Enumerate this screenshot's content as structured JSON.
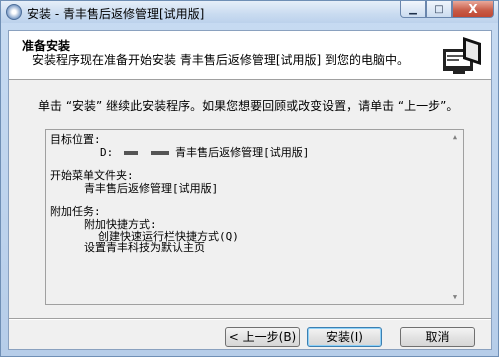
{
  "window": {
    "title": "安装 - 青丰售后返修管理[试用版]",
    "minimize_icon": "minimize-icon",
    "maximize_icon": "maximize-icon",
    "close_label": "X"
  },
  "header": {
    "title": "准备安装",
    "subtitle": "安装程序现在准备开始安装 青丰售后返修管理[试用版] 到您的电脑中。",
    "icon": "computer-install-icon"
  },
  "intro": "单击 “安装” 继续此安装程序。如果您想要回顾或改变设置，请单击 “上一步”。",
  "summary": {
    "dest_label": "目标位置:",
    "dest_drive": "D:",
    "dest_folder": "青丰售后返修管理[试用版]",
    "menu_label": "开始菜单文件夹:",
    "menu_value": "青丰售后返修管理[试用版]",
    "tasks_label": "附加任务:",
    "shortcuts_label": "附加快捷方式:",
    "quicklaunch": "创建快速运行栏快捷方式(Q)",
    "homepage": "设置青丰科技为默认主页"
  },
  "buttons": {
    "back": "< 上一步(B)",
    "install": "安装(I)",
    "cancel": "取消"
  },
  "colors": {
    "window_frame": "#b6cde9",
    "panel": "#f0f0f0",
    "close_button": "#c75a45"
  }
}
